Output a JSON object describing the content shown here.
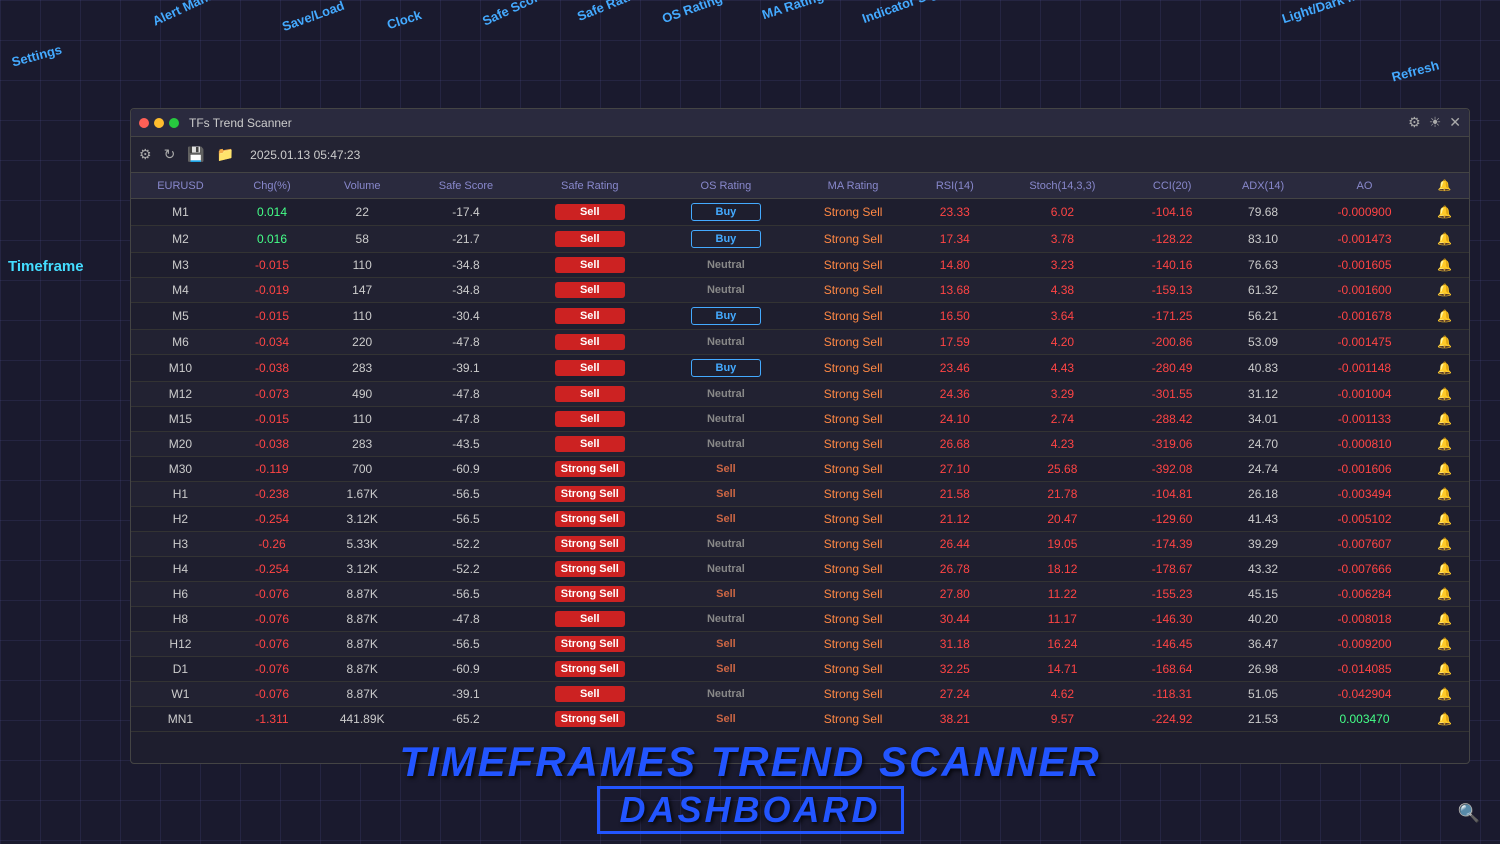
{
  "title": "TFs Trend Scanner",
  "datetime": "2025.01.13 05:47:23",
  "labels": {
    "settings": "Settings",
    "alert_manager": "Alert Manager",
    "save_load": "Save/Load",
    "clock": "Clock",
    "safe_score": "Safe Score",
    "safe_rating": "Safe Rating",
    "os_rating": "OS Rating",
    "ma_rating": "MA Rating",
    "indicator_signal": "Indicator Signal",
    "light_dark": "Light/Dark mode",
    "refresh": "Refresh",
    "timeframe": "Timeframe",
    "add_alert": "Add Alert"
  },
  "columns": [
    "EURUSD",
    "Chg(%)",
    "Volume",
    "Safe Score",
    "Safe Rating",
    "OS Rating",
    "MA Rating",
    "RSI(14)",
    "Stoch(14,3,3)",
    "CCI(20)",
    "ADX(14)",
    "AO"
  ],
  "rows": [
    {
      "tf": "M1",
      "chg": "0.014",
      "vol": "22",
      "ss": "-17.4",
      "sr": "Sell",
      "os": "Buy",
      "ma": "Strong Sell",
      "rsi": "23.33",
      "stoch": "6.02",
      "cci": "-104.16",
      "adx": "79.68",
      "ao": "-0.000900"
    },
    {
      "tf": "M2",
      "chg": "0.016",
      "vol": "58",
      "ss": "-21.7",
      "sr": "Sell",
      "os": "Buy",
      "ma": "Strong Sell",
      "rsi": "17.34",
      "stoch": "3.78",
      "cci": "-128.22",
      "adx": "83.10",
      "ao": "-0.001473"
    },
    {
      "tf": "M3",
      "chg": "-0.015",
      "vol": "110",
      "ss": "-34.8",
      "sr": "Sell",
      "os": "Neutral",
      "ma": "Strong Sell",
      "rsi": "14.80",
      "stoch": "3.23",
      "cci": "-140.16",
      "adx": "76.63",
      "ao": "-0.001605"
    },
    {
      "tf": "M4",
      "chg": "-0.019",
      "vol": "147",
      "ss": "-34.8",
      "sr": "Sell",
      "os": "Neutral",
      "ma": "Strong Sell",
      "rsi": "13.68",
      "stoch": "4.38",
      "cci": "-159.13",
      "adx": "61.32",
      "ao": "-0.001600"
    },
    {
      "tf": "M5",
      "chg": "-0.015",
      "vol": "110",
      "ss": "-30.4",
      "sr": "Sell",
      "os": "Buy",
      "ma": "Strong Sell",
      "rsi": "16.50",
      "stoch": "3.64",
      "cci": "-171.25",
      "adx": "56.21",
      "ao": "-0.001678"
    },
    {
      "tf": "M6",
      "chg": "-0.034",
      "vol": "220",
      "ss": "-47.8",
      "sr": "Sell",
      "os": "Neutral",
      "ma": "Strong Sell",
      "rsi": "17.59",
      "stoch": "4.20",
      "cci": "-200.86",
      "adx": "53.09",
      "ao": "-0.001475"
    },
    {
      "tf": "M10",
      "chg": "-0.038",
      "vol": "283",
      "ss": "-39.1",
      "sr": "Sell",
      "os": "Buy",
      "ma": "Strong Sell",
      "rsi": "23.46",
      "stoch": "4.43",
      "cci": "-280.49",
      "adx": "40.83",
      "ao": "-0.001148"
    },
    {
      "tf": "M12",
      "chg": "-0.073",
      "vol": "490",
      "ss": "-47.8",
      "sr": "Sell",
      "os": "Neutral",
      "ma": "Strong Sell",
      "rsi": "24.36",
      "stoch": "3.29",
      "cci": "-301.55",
      "adx": "31.12",
      "ao": "-0.001004"
    },
    {
      "tf": "M15",
      "chg": "-0.015",
      "vol": "110",
      "ss": "-47.8",
      "sr": "Sell",
      "os": "Neutral",
      "ma": "Strong Sell",
      "rsi": "24.10",
      "stoch": "2.74",
      "cci": "-288.42",
      "adx": "34.01",
      "ao": "-0.001133"
    },
    {
      "tf": "M20",
      "chg": "-0.038",
      "vol": "283",
      "ss": "-43.5",
      "sr": "Sell",
      "os": "Neutral",
      "ma": "Strong Sell",
      "rsi": "26.68",
      "stoch": "4.23",
      "cci": "-319.06",
      "adx": "24.70",
      "ao": "-0.000810"
    },
    {
      "tf": "M30",
      "chg": "-0.119",
      "vol": "700",
      "ss": "-60.9",
      "sr": "Strong Sell",
      "os": "Sell",
      "ma": "Strong Sell",
      "rsi": "27.10",
      "stoch": "25.68",
      "cci": "-392.08",
      "adx": "24.74",
      "ao": "-0.001606"
    },
    {
      "tf": "H1",
      "chg": "-0.238",
      "vol": "1.67K",
      "ss": "-56.5",
      "sr": "Strong Sell",
      "os": "Sell",
      "ma": "Strong Sell",
      "rsi": "21.58",
      "stoch": "21.78",
      "cci": "-104.81",
      "adx": "26.18",
      "ao": "-0.003494"
    },
    {
      "tf": "H2",
      "chg": "-0.254",
      "vol": "3.12K",
      "ss": "-56.5",
      "sr": "Strong Sell",
      "os": "Sell",
      "ma": "Strong Sell",
      "rsi": "21.12",
      "stoch": "20.47",
      "cci": "-129.60",
      "adx": "41.43",
      "ao": "-0.005102"
    },
    {
      "tf": "H3",
      "chg": "-0.26",
      "vol": "5.33K",
      "ss": "-52.2",
      "sr": "Strong Sell",
      "os": "Neutral",
      "ma": "Strong Sell",
      "rsi": "26.44",
      "stoch": "19.05",
      "cci": "-174.39",
      "adx": "39.29",
      "ao": "-0.007607"
    },
    {
      "tf": "H4",
      "chg": "-0.254",
      "vol": "3.12K",
      "ss": "-52.2",
      "sr": "Strong Sell",
      "os": "Neutral",
      "ma": "Strong Sell",
      "rsi": "26.78",
      "stoch": "18.12",
      "cci": "-178.67",
      "adx": "43.32",
      "ao": "-0.007666"
    },
    {
      "tf": "H6",
      "chg": "-0.076",
      "vol": "8.87K",
      "ss": "-56.5",
      "sr": "Strong Sell",
      "os": "Sell",
      "ma": "Strong Sell",
      "rsi": "27.80",
      "stoch": "11.22",
      "cci": "-155.23",
      "adx": "45.15",
      "ao": "-0.006284"
    },
    {
      "tf": "H8",
      "chg": "-0.076",
      "vol": "8.87K",
      "ss": "-47.8",
      "sr": "Sell",
      "os": "Neutral",
      "ma": "Strong Sell",
      "rsi": "30.44",
      "stoch": "11.17",
      "cci": "-146.30",
      "adx": "40.20",
      "ao": "-0.008018"
    },
    {
      "tf": "H12",
      "chg": "-0.076",
      "vol": "8.87K",
      "ss": "-56.5",
      "sr": "Strong Sell",
      "os": "Sell",
      "ma": "Strong Sell",
      "rsi": "31.18",
      "stoch": "16.24",
      "cci": "-146.45",
      "adx": "36.47",
      "ao": "-0.009200"
    },
    {
      "tf": "D1",
      "chg": "-0.076",
      "vol": "8.87K",
      "ss": "-60.9",
      "sr": "Strong Sell",
      "os": "Sell",
      "ma": "Strong Sell",
      "rsi": "32.25",
      "stoch": "14.71",
      "cci": "-168.64",
      "adx": "26.98",
      "ao": "-0.014085"
    },
    {
      "tf": "W1",
      "chg": "-0.076",
      "vol": "8.87K",
      "ss": "-39.1",
      "sr": "Sell",
      "os": "Neutral",
      "ma": "Strong Sell",
      "rsi": "27.24",
      "stoch": "4.62",
      "cci": "-118.31",
      "adx": "51.05",
      "ao": "-0.042904"
    },
    {
      "tf": "MN1",
      "chg": "-1.311",
      "vol": "441.89K",
      "ss": "-65.2",
      "sr": "Strong Sell",
      "os": "Sell",
      "ma": "Strong Sell",
      "rsi": "38.21",
      "stoch": "9.57",
      "cci": "-224.92",
      "adx": "21.53",
      "ao": "0.003470"
    }
  ],
  "banner": {
    "line1": "TIMEFRAMES TREND SCANNER",
    "line2": "DASHBOARD"
  },
  "colors": {
    "accent_blue": "#44aaff",
    "strong_sell_bg": "#cc2222",
    "sell_badge_bg": "#cc2222",
    "buy_color": "#44aaff",
    "red_text": "#ff4444",
    "green_text": "#44ff88"
  }
}
